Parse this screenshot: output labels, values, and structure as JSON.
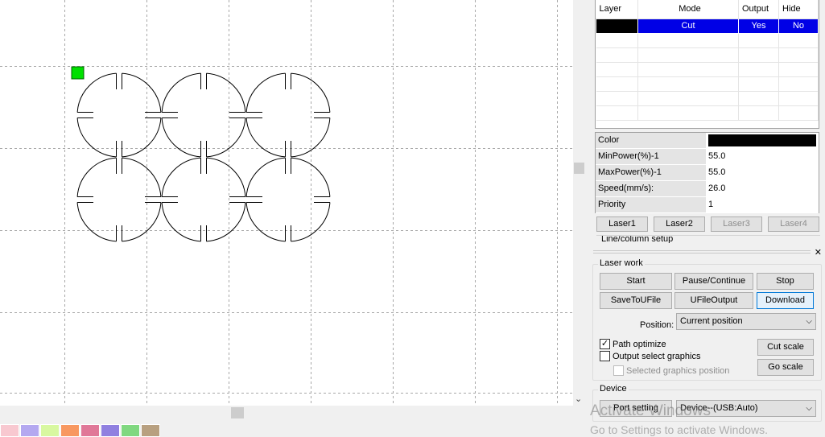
{
  "layers": {
    "columns": [
      "Layer",
      "Mode",
      "Output",
      "Hide"
    ],
    "rows": [
      {
        "color": "#000000",
        "mode": "Cut",
        "output": "Yes",
        "hide": "No"
      }
    ]
  },
  "properties": [
    {
      "key": "Color",
      "value": "",
      "color": "#000000"
    },
    {
      "key": "MinPower(%)-1",
      "value": "55.0"
    },
    {
      "key": "MaxPower(%)-1",
      "value": "55.0"
    },
    {
      "key": "Speed(mm/s):",
      "value": "26.0"
    },
    {
      "key": "Priority",
      "value": "1"
    }
  ],
  "laser_tabs": [
    {
      "label": "Laser1",
      "enabled": true
    },
    {
      "label": "Laser2",
      "enabled": true
    },
    {
      "label": "Laser3",
      "enabled": false
    },
    {
      "label": "Laser4",
      "enabled": false
    }
  ],
  "line_column_label": "Line/column setup",
  "laser_work": {
    "title": "Laser work",
    "start": "Start",
    "pause": "Pause/Continue",
    "stop": "Stop",
    "save_to_ufile": "SaveToUFile",
    "ufile_output": "UFileOutput",
    "download": "Download",
    "position_label": "Position:",
    "position_value": "Current position",
    "path_optimize": "Path optimize",
    "path_optimize_checked": true,
    "output_select": "Output select graphics",
    "output_select_checked": false,
    "selected_position": "Selected graphics position",
    "cut_scale": "Cut scale",
    "go_scale": "Go scale"
  },
  "device": {
    "title": "Device",
    "port_setting": "Port setting",
    "device_value": "Device--(USB:Auto)"
  },
  "watermark": {
    "line1": "Activate Windows",
    "line2": "Go to Settings to activate Windows."
  },
  "palette": [
    "#f8c8d0",
    "#b4a8f0",
    "#d8f8a0",
    "#f89860",
    "#e07898",
    "#9080e0",
    "#80d880",
    "#b8a080"
  ],
  "colors": {
    "selection": "#0000e6",
    "marker": "#00e000"
  }
}
